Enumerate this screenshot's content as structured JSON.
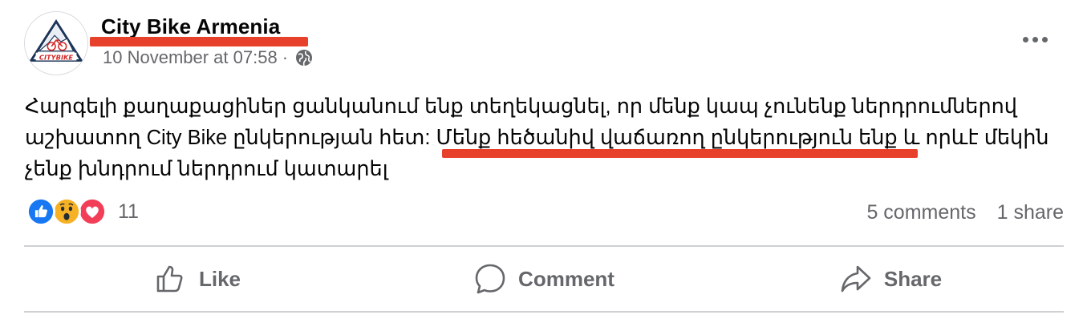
{
  "post": {
    "page_name": "City Bike Armenia",
    "timestamp": "10 November at 07:58",
    "separator": "·",
    "body_lines": [
      "Հարգելի քաղաքացիներ ցանկանում ենք տեղեկացնել, որ մենք կապ չունենք  ներդրումներով",
      "աշխատող City Bike ընկերության հետ: Մենք հեծանիվ վաճառող ընկերություն ենք և որևէ մեկին",
      "չենք խնդրում ներդրում կատարել"
    ],
    "avatar_logo_text": "CITYBIKE"
  },
  "reactions": {
    "icons": [
      "like-icon",
      "wow-icon",
      "love-icon"
    ],
    "count": "11",
    "colors": {
      "like": "#1877f2",
      "love": "#f33e58",
      "wow": "#f7b125"
    }
  },
  "stats": {
    "comments": "5 comments",
    "shares": "1 share"
  },
  "actions": {
    "like": "Like",
    "comment": "Comment",
    "share": "Share"
  },
  "annotation": {
    "highlight_color": "#e8412b"
  }
}
